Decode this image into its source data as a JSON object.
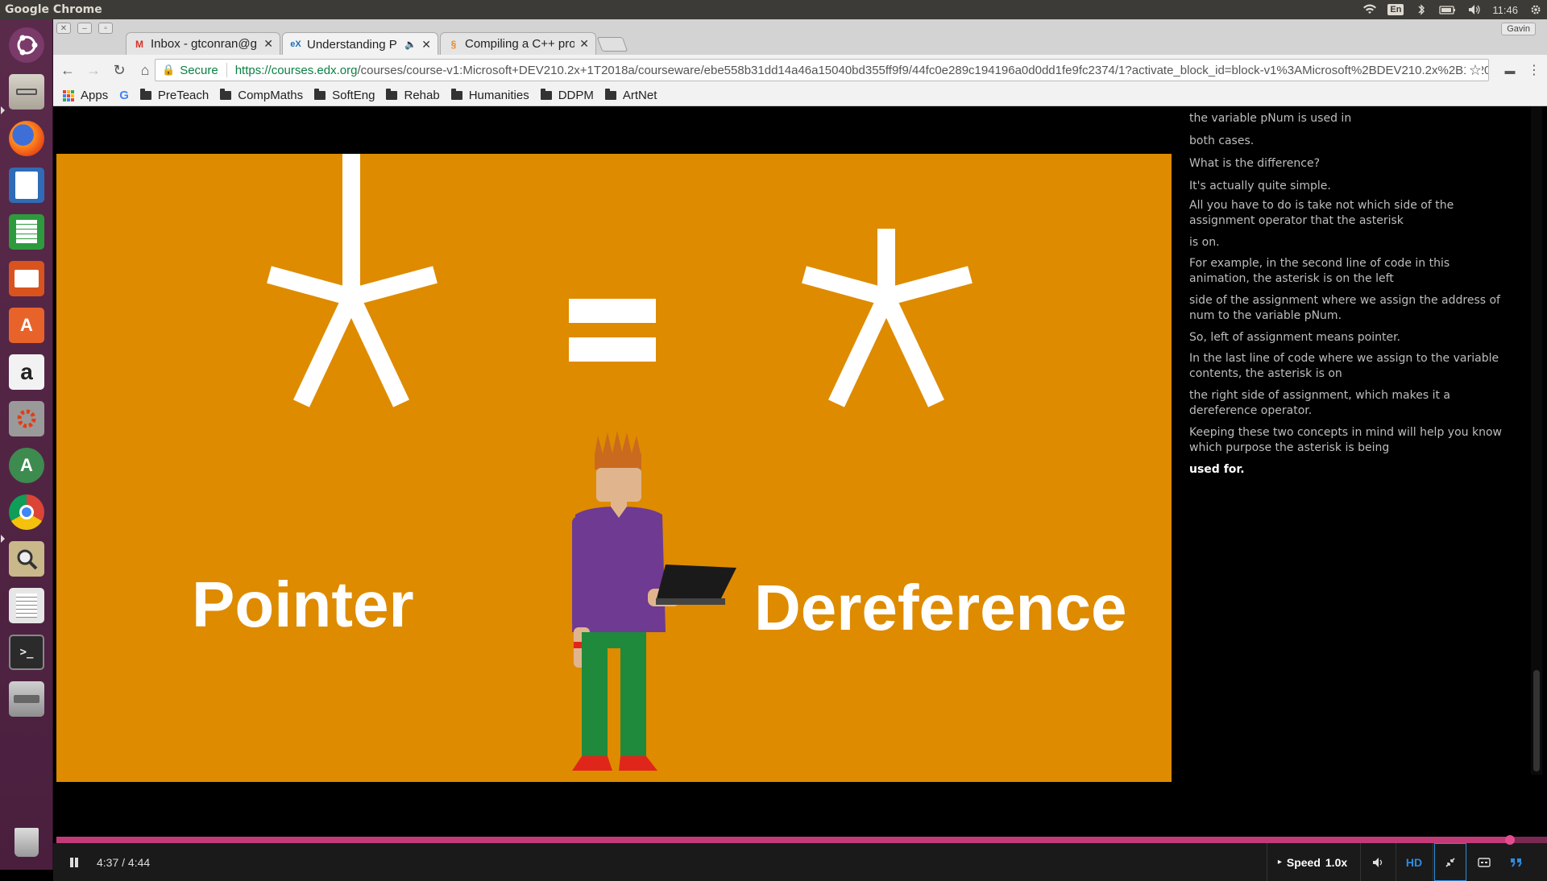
{
  "panel": {
    "app_title": "Google Chrome",
    "lang": "En",
    "time": "11:46"
  },
  "window": {
    "profile": "Gavin",
    "tabs": [
      {
        "label": "Inbox - gtconran@g",
        "favicon": "gmail-icon"
      },
      {
        "label": "Understanding P",
        "favicon": "edx-icon"
      },
      {
        "label": "Compiling a C++ pro",
        "favicon": "page-icon"
      }
    ],
    "omnibox": {
      "secure_label": "Secure",
      "url_scheme_host": "https://courses.edx.org",
      "url_path": "/courses/course-v1:Microsoft+DEV210.2x+1T2018a/courseware/ebe558b31dd14a46a15040bd355ff9f9/44fc0e289c194196a0d0dd1fe9fc2374/1?activate_block_id=block-v1%3AMicrosoft%2BDEV210.2x%2B1T2018a%..."
    },
    "bookmarks": [
      "Apps",
      "G",
      "PreTeach",
      "CompMaths",
      "SoftEng",
      "Rehab",
      "Humanities",
      "DDPM",
      "ArtNet"
    ]
  },
  "video": {
    "equation_lhs": "*",
    "equation_op": "=",
    "equation_rhs": "*",
    "left_word": "Pointer",
    "right_word": "Dereference",
    "colors": {
      "background": "#de8b00",
      "shirt": "#6e3a92",
      "pants": "#1f8a3c",
      "hair": "#c96a1f",
      "shoes": "#e0261b"
    }
  },
  "transcript": {
    "lines": [
      {
        "text": "the variable pNum is used in",
        "current": false
      },
      {
        "text": "both cases.",
        "current": false
      },
      {
        "text": "What is the difference?",
        "current": false
      },
      {
        "text": "It's actually quite simple.",
        "current": false
      },
      {
        "text": "All you have to do is take not which side of the assignment operator that the asterisk",
        "current": false
      },
      {
        "text": "is on.",
        "current": false
      },
      {
        "text": "For example, in the second line of code in this animation, the asterisk is on the left",
        "current": false
      },
      {
        "text": "side of the assignment where we assign the address of num to the variable pNum.",
        "current": false
      },
      {
        "text": "So, left of assignment means pointer.",
        "current": false
      },
      {
        "text": "In the last line of code where we assign to the variable contents, the asterisk is on",
        "current": false
      },
      {
        "text": "the right side of assignment, which makes it a dereference operator.",
        "current": false
      },
      {
        "text": "Keeping these two concepts in mind will help you know which purpose the asterisk is being",
        "current": false
      },
      {
        "text": "used for.",
        "current": true
      }
    ]
  },
  "player": {
    "time": "4:37 / 4:44",
    "progress": 0.975,
    "speed_label": "Speed",
    "speed_value": "1.0x",
    "hd_label": "HD"
  }
}
